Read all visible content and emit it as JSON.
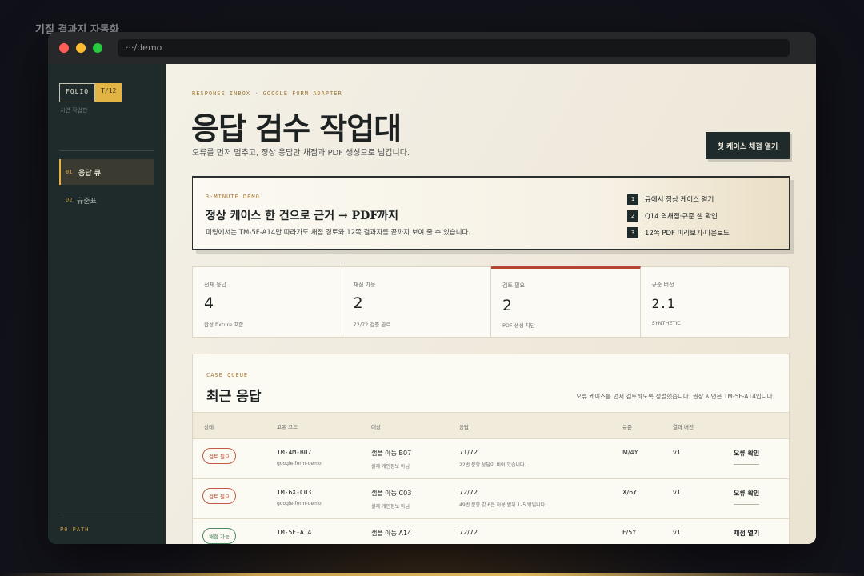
{
  "page_caption": "기질 결과지 자동화",
  "browser": {
    "url": "···/demo"
  },
  "sidebar": {
    "logo_left": "FOLIO",
    "logo_right": "T/12",
    "subtitle": "시연 작업판",
    "items": [
      {
        "num": "01",
        "label": "응답 큐",
        "active": true
      },
      {
        "num": "02",
        "label": "규준표",
        "active": false
      }
    ],
    "footer": "P0 PATH"
  },
  "header": {
    "eyebrow": "RESPONSE INBOX · GOOGLE FORM ADAPTER",
    "title": "응답 검수 작업대",
    "subtitle": "오류를 먼저 멈추고, 정상 응답만 채점과 PDF 생성으로 넘깁니다.",
    "primary_button": "첫 케이스 채점 열기"
  },
  "demo": {
    "eyebrow": "3-MINUTE DEMO",
    "title": "정상 케이스 한 건으로 근거 → PDF까지",
    "desc": "미팅에서는 TM-5F-A14만 따라가도 채점 경로와 12쪽 결과지를 끝까지 보여 줄 수 있습니다.",
    "steps": [
      {
        "num": "1",
        "text": "큐에서 정상 케이스 열기"
      },
      {
        "num": "2",
        "text": "Q14 역채점·규준 셀 확인"
      },
      {
        "num": "3",
        "text": "12쪽 PDF 미리보기·다운로드"
      }
    ]
  },
  "stats": [
    {
      "label": "전체 응답",
      "value": "4",
      "note": "합성 fixture 포함",
      "alert": false,
      "mono": false
    },
    {
      "label": "채점 가능",
      "value": "2",
      "note": "72/72 검증 완료",
      "alert": false,
      "mono": false
    },
    {
      "label": "검토 필요",
      "value": "2",
      "note": "PDF 생성 차단",
      "alert": true,
      "mono": false
    },
    {
      "label": "규준 버전",
      "value": "2.1",
      "note": "SYNTHETIC",
      "alert": false,
      "mono": true
    }
  ],
  "queue": {
    "eyebrow": "CASE QUEUE",
    "title": "최근 응답",
    "hint": "오류 케이스를 먼저 검토하도록 정렬했습니다. 권장 시연은 TM-5F-A14입니다.",
    "columns": [
      "상태",
      "고유 코드",
      "대상",
      "응답",
      "규준",
      "결과 버전"
    ],
    "rows": [
      {
        "status": "검토 필요",
        "status_type": "review",
        "code": "TM-4M-B07",
        "source": "google-form-demo",
        "subject": "샘플 아동 B07",
        "subject_note": "실제 개인정보 아님",
        "response": "71/72",
        "response_note": "22번 문항 응답이 비어 있습니다.",
        "norm": "M/4Y",
        "version": "v1",
        "action": "오류 확인"
      },
      {
        "status": "검토 필요",
        "status_type": "review",
        "code": "TM-6X-C03",
        "source": "google-form-demo",
        "subject": "샘플 아동 C03",
        "subject_note": "실제 개인정보 아님",
        "response": "72/72",
        "response_note": "49번 문항 값 6은 허용 범위 1–5 밖입니다.",
        "norm": "X/6Y",
        "version": "v1",
        "action": "오류 확인"
      },
      {
        "status": "채점 가능",
        "status_type": "ok",
        "code": "TM-5F-A14",
        "source": "",
        "subject": "샘플 아동 A14",
        "subject_note": "",
        "response": "72/72",
        "response_note": "",
        "norm": "F/5Y",
        "version": "v1",
        "action": "채점 열기"
      }
    ]
  },
  "colors": {
    "accent": "#e2b443",
    "sidebar": "#1f2b2b",
    "alert": "#b5452f",
    "ok": "#3f7a53"
  }
}
